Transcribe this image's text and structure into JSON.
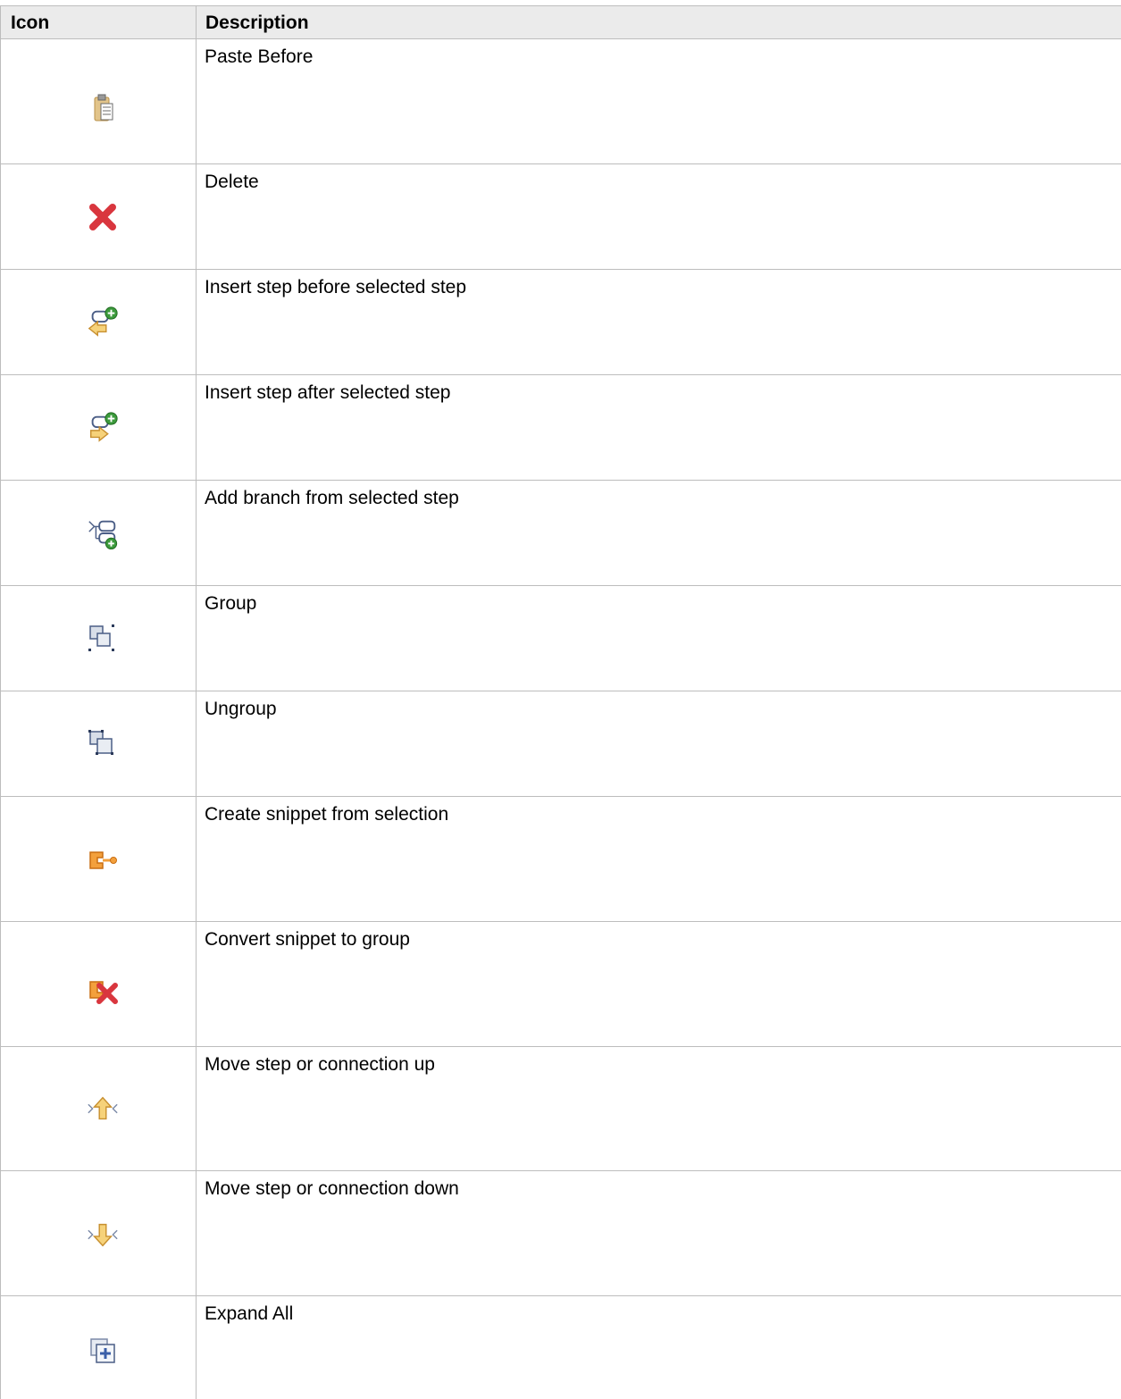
{
  "table": {
    "headers": [
      "Icon",
      "Description"
    ],
    "rows": [
      {
        "icon": "paste-before-icon",
        "description": "Paste Before"
      },
      {
        "icon": "delete-icon",
        "description": "Delete"
      },
      {
        "icon": "insert-step-before-icon",
        "description": "Insert step before selected step"
      },
      {
        "icon": "insert-step-after-icon",
        "description": "Insert step after selected step"
      },
      {
        "icon": "add-branch-icon",
        "description": "Add branch from selected step"
      },
      {
        "icon": "group-icon",
        "description": "Group"
      },
      {
        "icon": "ungroup-icon",
        "description": "Ungroup"
      },
      {
        "icon": "create-snippet-icon",
        "description": "Create snippet from selection"
      },
      {
        "icon": "convert-snippet-icon",
        "description": "Convert snippet to group"
      },
      {
        "icon": "move-up-icon",
        "description": "Move step or connection up"
      },
      {
        "icon": "move-down-icon",
        "description": "Move step or connection down"
      },
      {
        "icon": "expand-all-icon",
        "description": "Expand All"
      }
    ]
  },
  "colors": {
    "header_bg": "#ebebeb",
    "border": "#bdbdbd",
    "delete_red": "#d9363e",
    "add_green": "#3c9a3c",
    "arrow_orange": "#f0b040"
  }
}
